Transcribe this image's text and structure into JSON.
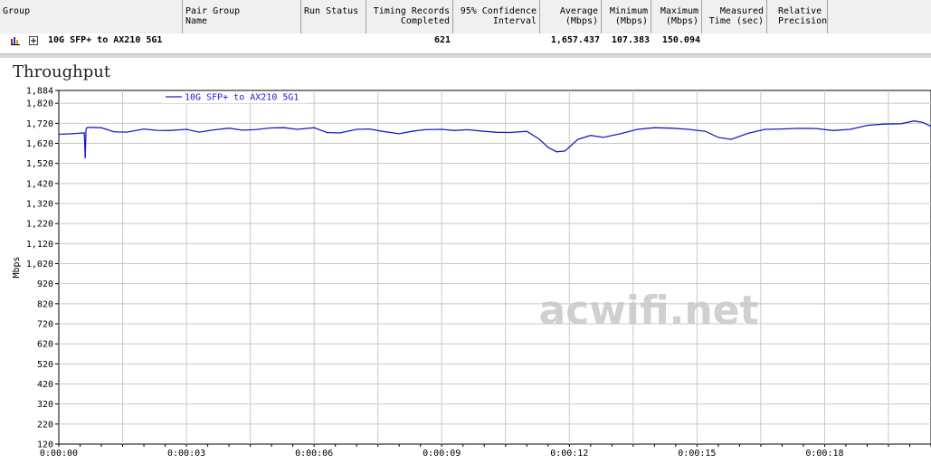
{
  "columns": [
    {
      "label_lines": [
        "",
        "Group"
      ],
      "align": "left"
    },
    {
      "label_lines": [
        "Pair Group",
        "Name"
      ],
      "align": "left"
    },
    {
      "label_lines": [
        "",
        "Run Status"
      ],
      "align": "left"
    },
    {
      "label_lines": [
        "Timing Records",
        "Completed"
      ],
      "align": "right"
    },
    {
      "label_lines": [
        "95% Confidence",
        "Interval"
      ],
      "align": "right"
    },
    {
      "label_lines": [
        "Average",
        "(Mbps)"
      ],
      "align": "right"
    },
    {
      "label_lines": [
        "Minimum",
        "(Mbps)"
      ],
      "align": "right"
    },
    {
      "label_lines": [
        "Maximum",
        "(Mbps)"
      ],
      "align": "right"
    },
    {
      "label_lines": [
        "Measured",
        "Time (sec)"
      ],
      "align": "right"
    },
    {
      "label_lines": [
        "Relative",
        "Precision"
      ],
      "align": "left"
    }
  ],
  "row": {
    "name": "10G SFP+ to AX210 5G1",
    "timing_records": "621",
    "average": "1,657.437",
    "minimum": "107.383",
    "maximum": "150.094",
    "icons": [
      "bar-chart-icon",
      "expand-plus-icon"
    ]
  },
  "chart_title": "Throughput",
  "chart_data": {
    "type": "line",
    "title": "Throughput",
    "xlabel": "",
    "ylabel": "Mbps",
    "ylim": [
      120,
      1884
    ],
    "xlim": [
      0,
      20.5
    ],
    "y_ticks": [
      "1,884",
      "1,820",
      "1,720",
      "1,620",
      "1,520",
      "1,420",
      "1,320",
      "1,220",
      "1,120",
      "1,020",
      "920",
      "820",
      "720",
      "620",
      "520",
      "420",
      "320",
      "220",
      "120"
    ],
    "x_ticks": [
      "0:00:00",
      "0:00:03",
      "0:00:06",
      "0:00:09",
      "0:00:12",
      "0:00:15",
      "0:00:18"
    ],
    "legend": "top-left",
    "grid": true,
    "series": [
      {
        "name": "10G SFP+ to AX210 5G1",
        "color": "#1c1ccc",
        "x": [
          0,
          0.3,
          0.6,
          0.62,
          0.64,
          0.66,
          0.7,
          1.0,
          1.3,
          1.6,
          2.0,
          2.3,
          2.6,
          3.0,
          3.3,
          3.6,
          4.0,
          4.3,
          4.6,
          5.0,
          5.3,
          5.6,
          6.0,
          6.3,
          6.6,
          7.0,
          7.3,
          7.6,
          8.0,
          8.3,
          8.6,
          9.0,
          9.3,
          9.6,
          10.0,
          10.3,
          10.6,
          11.0,
          11.3,
          11.5,
          11.7,
          11.9,
          12.2,
          12.5,
          12.8,
          13.2,
          13.6,
          14.0,
          14.4,
          14.8,
          15.2,
          15.5,
          15.8,
          16.2,
          16.6,
          17.0,
          17.4,
          17.8,
          18.2,
          18.6,
          19.0,
          19.4,
          19.8,
          20.1,
          20.3,
          20.5
        ],
        "y": [
          1665,
          1668,
          1672,
          1545,
          1690,
          1698,
          1700,
          1698,
          1678,
          1676,
          1692,
          1685,
          1684,
          1690,
          1676,
          1686,
          1696,
          1686,
          1688,
          1697,
          1698,
          1690,
          1698,
          1674,
          1672,
          1690,
          1692,
          1680,
          1668,
          1680,
          1688,
          1690,
          1684,
          1688,
          1680,
          1675,
          1674,
          1680,
          1640,
          1600,
          1578,
          1582,
          1640,
          1660,
          1650,
          1668,
          1690,
          1698,
          1696,
          1690,
          1680,
          1650,
          1640,
          1670,
          1690,
          1692,
          1695,
          1694,
          1684,
          1690,
          1710,
          1716,
          1718,
          1732,
          1725,
          1705
        ]
      }
    ]
  },
  "watermark": "acwifi.net"
}
